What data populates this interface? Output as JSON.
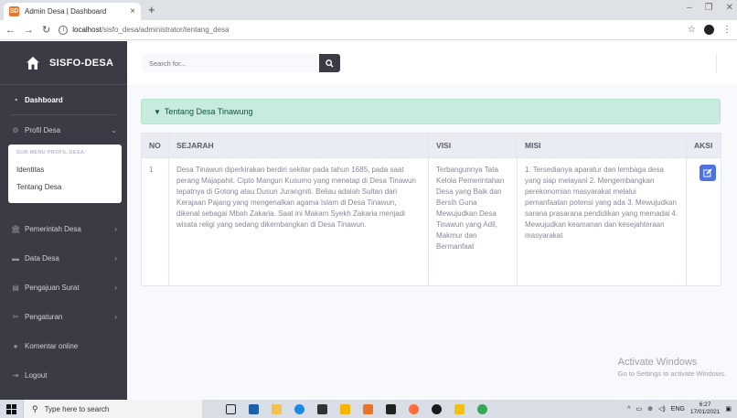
{
  "browser": {
    "tab_title": "Admin Desa | Dashboard",
    "tab_favicon": "SD",
    "url_host": "localhost",
    "url_path": "/sisfo_desa/administrator/tentang_desa"
  },
  "sidebar": {
    "brand": "SISFO-DESA",
    "dashboard": "Dashboard",
    "profil": "Profil Desa",
    "submenu_header": "SUB-MENU PROFIL DESA:",
    "submenu_items": [
      "Identitas",
      "Tentang Desa"
    ],
    "pemerintah": "Pemerintah Desa",
    "data": "Data Desa",
    "pengajuan": "Pengajuan Surat",
    "pengaturan": "Pengaturan",
    "komentar": "Komentar online",
    "logout": "Logout"
  },
  "topbar": {
    "search_placeholder": "Search for..."
  },
  "main": {
    "alert": "Tentang Desa Tinawung",
    "table": {
      "headers": [
        "NO",
        "SEJARAH",
        "VISI",
        "MISI",
        "AKSI"
      ],
      "rows": [
        {
          "no": "1",
          "sejarah": "Desa Tinawun diperkirakan berdiri sekitar pada tahun 1685, pada saat perang Majapahit. Cipto Mangun Kusumo yang menetap di Desa Tinawun tepatnya di Gotong atau Dusun Jurangniti. Beliau adalah Sultan dari Kerajaan Pajang yang mengenalkan agama Islam di Desa Tinawun, dikenal sebagai Mbah Zakaria. Saat ini Makam Syekh Zakaria menjadi wisata religi yang sedang dikembangkan di Desa Tinawun.",
          "visi": "Terbangunnya Tata Kelola Pemerintahan Desa yang Baik dan Bersih Guna Mewujudkan Desa Tinawun yang Adil, Makmur dan Bermanfaat",
          "misi": "1. Tersedianya aparatur dan lembaga desa yang siap melayani 2. Mengembangkan perekonomian masyarakat melalui pemanfaatan potensi yang ada 3. Mewujudkan sarana prasarana pendidikan yang memadai 4. Mewujudkan keamanan dan kesejahteraan masyarakat"
        }
      ]
    }
  },
  "watermark": {
    "title": "Activate Windows",
    "subtitle": "Go to Settings to activate Windows."
  },
  "taskbar": {
    "search_placeholder": "Type here to search",
    "lang": "ENG",
    "time": "6:27",
    "date": "17/01/2021"
  },
  "colors": {
    "sidebar_bg": "#3a3b45",
    "alert_bg": "#c7ebdc",
    "edit_button": "#4e73df"
  }
}
